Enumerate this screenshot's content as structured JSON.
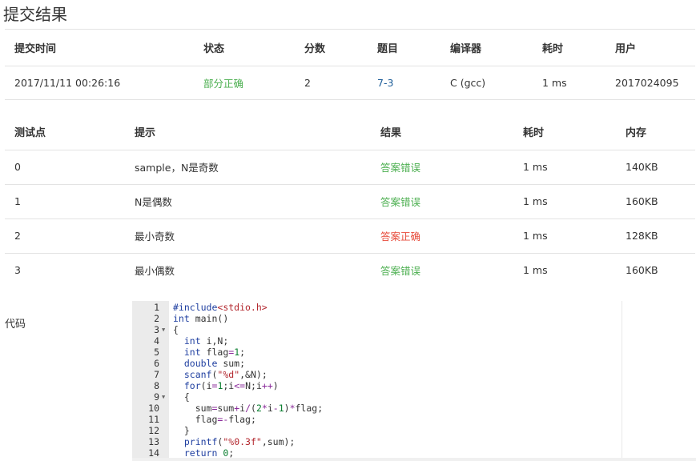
{
  "title": "提交结果",
  "submission": {
    "headers": [
      "提交时间",
      "状态",
      "分数",
      "题目",
      "编译器",
      "耗时",
      "用户"
    ],
    "row": {
      "time": "2017/11/11 00:26:16",
      "status": "部分正确",
      "score": "2",
      "problem": "7-3",
      "compiler": "C (gcc)",
      "duration": "1 ms",
      "user": "2017024095"
    }
  },
  "tests": {
    "headers": [
      "测试点",
      "提示",
      "结果",
      "耗时",
      "内存"
    ],
    "rows": [
      {
        "id": "0",
        "hint": "sample，N是奇数",
        "result": "答案错误",
        "time": "1 ms",
        "memory": "140KB"
      },
      {
        "id": "1",
        "hint": "N是偶数",
        "result": "答案错误",
        "time": "1 ms",
        "memory": "160KB"
      },
      {
        "id": "2",
        "hint": "最小奇数",
        "result": "答案正确",
        "time": "1 ms",
        "memory": "128KB"
      },
      {
        "id": "3",
        "hint": "最小偶数",
        "result": "答案错误",
        "time": "1 ms",
        "memory": "160KB"
      }
    ]
  },
  "code_label": "代码",
  "colors": {
    "result_wrong": "#4caf50",
    "result_correct": "#e74c3c",
    "status_partial": "#4caf50",
    "link": "#1f5f9a"
  },
  "code_lines": [
    {
      "n": "1",
      "text": "#include<stdio.h>"
    },
    {
      "n": "2",
      "text": "int main()"
    },
    {
      "n": "3",
      "text": "{",
      "fold": true
    },
    {
      "n": "4",
      "text": "  int i,N;"
    },
    {
      "n": "5",
      "text": "  int flag=1;"
    },
    {
      "n": "6",
      "text": "  double sum;"
    },
    {
      "n": "7",
      "text": "  scanf(\"%d\",&N);"
    },
    {
      "n": "8",
      "text": "  for(i=1;i<=N;i++)"
    },
    {
      "n": "9",
      "text": "  {",
      "fold": true
    },
    {
      "n": "10",
      "text": "    sum=sum+i/(2*i-1)*flag;"
    },
    {
      "n": "11",
      "text": "    flag=-flag;"
    },
    {
      "n": "12",
      "text": "  }"
    },
    {
      "n": "13",
      "text": "  printf(\"%0.3f\",sum);"
    },
    {
      "n": "14",
      "text": "  return 0;"
    }
  ]
}
